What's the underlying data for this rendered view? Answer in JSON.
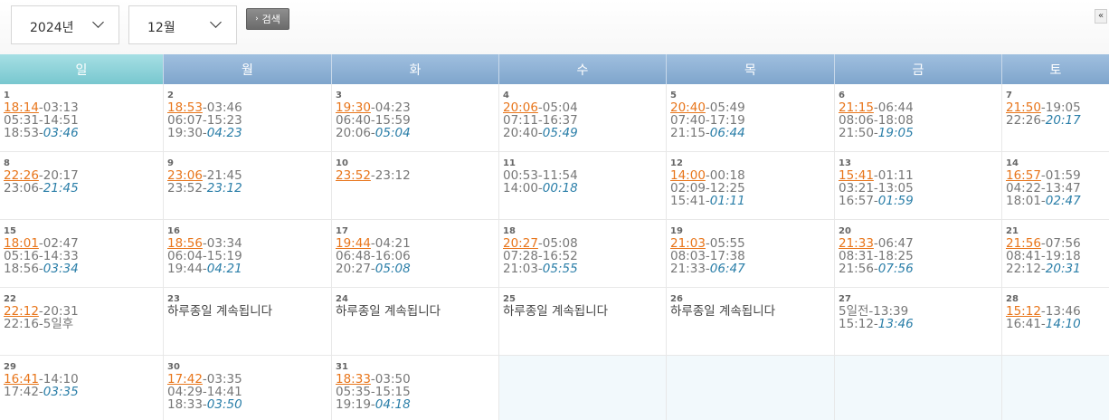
{
  "toolbar": {
    "year": "2024년",
    "month": "12월",
    "search_label": "검색",
    "collapse_label": "«"
  },
  "weekdays": [
    "일",
    "월",
    "화",
    "수",
    "목",
    "금",
    "토"
  ],
  "colors": {
    "rise": "#e8751a",
    "set": "#2a7ea8",
    "header": "#7fa5cc",
    "header_sun": "#78c7cf"
  },
  "weeks": [
    [
      {
        "day": "1",
        "rise": "18:14",
        "rest1": "-03:13",
        "l2": "05:31-14:51",
        "l3a": "18:53-",
        "l3b": "03:46"
      },
      {
        "day": "2",
        "rise": "18:53",
        "rest1": "-03:46",
        "l2": "06:07-15:23",
        "l3a": "19:30-",
        "l3b": "04:23"
      },
      {
        "day": "3",
        "rise": "19:30",
        "rest1": "-04:23",
        "l2": "06:40-15:59",
        "l3a": "20:06-",
        "l3b": "05:04"
      },
      {
        "day": "4",
        "rise": "20:06",
        "rest1": "-05:04",
        "l2": "07:11-16:37",
        "l3a": "20:40-",
        "l3b": "05:49"
      },
      {
        "day": "5",
        "rise": "20:40",
        "rest1": "-05:49",
        "l2": "07:40-17:19",
        "l3a": "21:15-",
        "l3b": "06:44"
      },
      {
        "day": "6",
        "rise": "21:15",
        "rest1": "-06:44",
        "l2": "08:06-18:08",
        "l3a": "21:50-",
        "l3b": "19:05"
      },
      {
        "day": "7",
        "rise": "21:50",
        "rest1": "-19:05",
        "l2a": "22:26-",
        "l2b": "20:17"
      }
    ],
    [
      {
        "day": "8",
        "rise": "22:26",
        "rest1": "-20:17",
        "l2a": "23:06-",
        "l2b": "21:45"
      },
      {
        "day": "9",
        "rise": "23:06",
        "rest1": "-21:45",
        "l2a": "23:52-",
        "l2b": "23:12"
      },
      {
        "day": "10",
        "rise": "23:52",
        "rest1": "-23:12"
      },
      {
        "day": "11",
        "plain1": "00:53-11:54",
        "l2a": "14:00-",
        "l2b": "00:18"
      },
      {
        "day": "12",
        "rise": "14:00",
        "rest1": "-00:18",
        "l2": "02:09-12:25",
        "l3a": "15:41-",
        "l3b": "01:11"
      },
      {
        "day": "13",
        "rise": "15:41",
        "rest1": "-01:11",
        "l2": "03:21-13:05",
        "l3a": "16:57-",
        "l3b": "01:59"
      },
      {
        "day": "14",
        "rise": "16:57",
        "rest1": "-01:59",
        "l2": "04:22-13:47",
        "l3a": "18:01-",
        "l3b": "02:47"
      }
    ],
    [
      {
        "day": "15",
        "rise": "18:01",
        "rest1": "-02:47",
        "l2": "05:16-14:33",
        "l3a": "18:56-",
        "l3b": "03:34"
      },
      {
        "day": "16",
        "rise": "18:56",
        "rest1": "-03:34",
        "l2": "06:04-15:19",
        "l3a": "19:44-",
        "l3b": "04:21"
      },
      {
        "day": "17",
        "rise": "19:44",
        "rest1": "-04:21",
        "l2": "06:48-16:06",
        "l3a": "20:27-",
        "l3b": "05:08"
      },
      {
        "day": "18",
        "rise": "20:27",
        "rest1": "-05:08",
        "l2": "07:28-16:52",
        "l3a": "21:03-",
        "l3b": "05:55"
      },
      {
        "day": "19",
        "rise": "21:03",
        "rest1": "-05:55",
        "l2": "08:03-17:38",
        "l3a": "21:33-",
        "l3b": "06:47"
      },
      {
        "day": "20",
        "rise": "21:33",
        "rest1": "-06:47",
        "l2": "08:31-18:25",
        "l3a": "21:56-",
        "l3b": "07:56"
      },
      {
        "day": "21",
        "rise": "21:56",
        "rest1": "-07:56",
        "l2": "08:41-19:18",
        "l3a": "22:12-",
        "l3b": "20:31"
      }
    ],
    [
      {
        "day": "22",
        "rise": "22:12",
        "rest1": "-20:31",
        "l2": "22:16-5일후"
      },
      {
        "day": "23",
        "cont": "하루종일 계속됩니다"
      },
      {
        "day": "24",
        "cont": "하루종일 계속됩니다"
      },
      {
        "day": "25",
        "cont": "하루종일 계속됩니다"
      },
      {
        "day": "26",
        "cont": "하루종일 계속됩니다"
      },
      {
        "day": "27",
        "plain1": "5일전-13:39",
        "l2a": "15:12-",
        "l2b": "13:46"
      },
      {
        "day": "28",
        "rise": "15:12",
        "rest1": "-13:46",
        "l2a": "16:41-",
        "l2b": "14:10"
      }
    ],
    [
      {
        "day": "29",
        "rise": "16:41",
        "rest1": "-14:10",
        "l2a": "17:42-",
        "l2b": "03:35"
      },
      {
        "day": "30",
        "rise": "17:42",
        "rest1": "-03:35",
        "l2": "04:29-14:41",
        "l3a": "18:33-",
        "l3b": "03:50"
      },
      {
        "day": "31",
        "rise": "18:33",
        "rest1": "-03:50",
        "l2": "05:35-15:15",
        "l3a": "19:19-",
        "l3b": "04:18"
      },
      {
        "empty": true
      },
      {
        "empty": true
      },
      {
        "empty": true
      },
      {
        "empty": true
      }
    ]
  ]
}
